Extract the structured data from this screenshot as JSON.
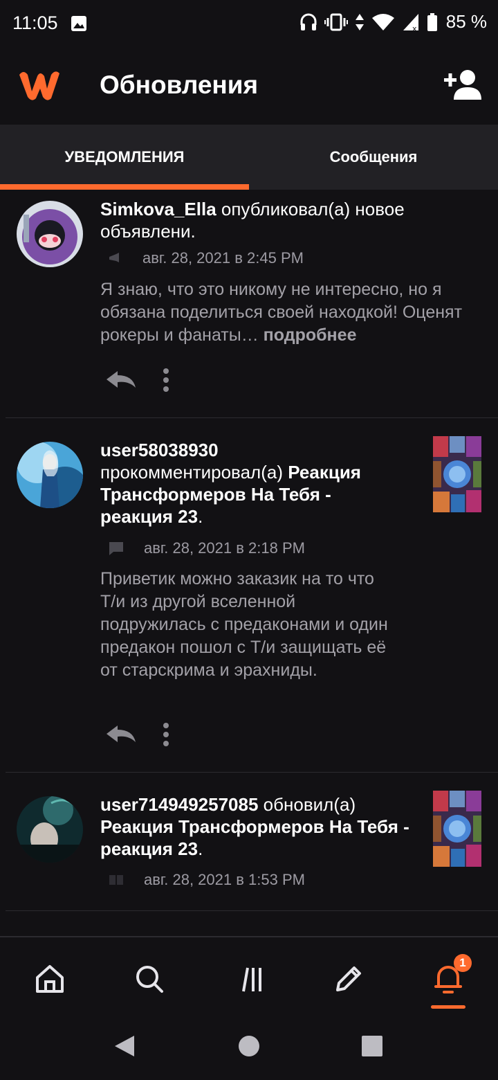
{
  "status_bar": {
    "time": "11:05",
    "battery": "85 %",
    "icons": [
      "image-icon",
      "headphones-icon",
      "vibrate-icon",
      "data-arrows-icon",
      "wifi-icon",
      "cell-signal-icon",
      "battery-icon"
    ]
  },
  "app_bar": {
    "title": "Обновления",
    "logo_icon": "wattpad-logo",
    "add_user_icon": "add-user-icon",
    "accent": "#ff6a2e"
  },
  "tabs": [
    {
      "label": "УВЕДОМЛЕНИЯ",
      "active": true
    },
    {
      "label": "Сообщения",
      "active": false
    }
  ],
  "feed": [
    {
      "user": "Simkova_Ella",
      "action": " опубликовал(а) новое объявлени.",
      "timestamp": "авг. 28, 2021 в 2:45 PM",
      "type_icon": "megaphone-icon",
      "message": "Я знаю, что это никому не интересно, но я обязана поделиться своей находкой! Оценят рокеры и фанаты…",
      "more": " подробнее"
    },
    {
      "user": "user58038930",
      "action": " прокомментировал(а) ",
      "target": "Реакция Трансформеров На Тебя - реакция 23",
      "suffix": ".",
      "timestamp": "авг. 28, 2021 в 2:18 PM",
      "type_icon": "comment-icon",
      "message": "Приветик можно заказик на то что Т/и из другой вселенной подружилась с предаконами и один предакон пошол с Т/и защищать её от старскрима и эрахниды."
    },
    {
      "user": "user714949257085",
      "action": " обновил(а) ",
      "target": "Реакция Трансформеров На Тебя - реакция 23",
      "suffix": ".",
      "timestamp": "авг. 28, 2021 в 1:53 PM",
      "type_icon": "book-icon"
    }
  ],
  "bottom_nav": {
    "items": [
      "home-icon",
      "search-icon",
      "library-icon",
      "write-icon",
      "notifications-icon"
    ],
    "notification_badge": "1"
  },
  "system_nav": [
    "back-icon",
    "home-circle-icon",
    "recents-icon"
  ]
}
